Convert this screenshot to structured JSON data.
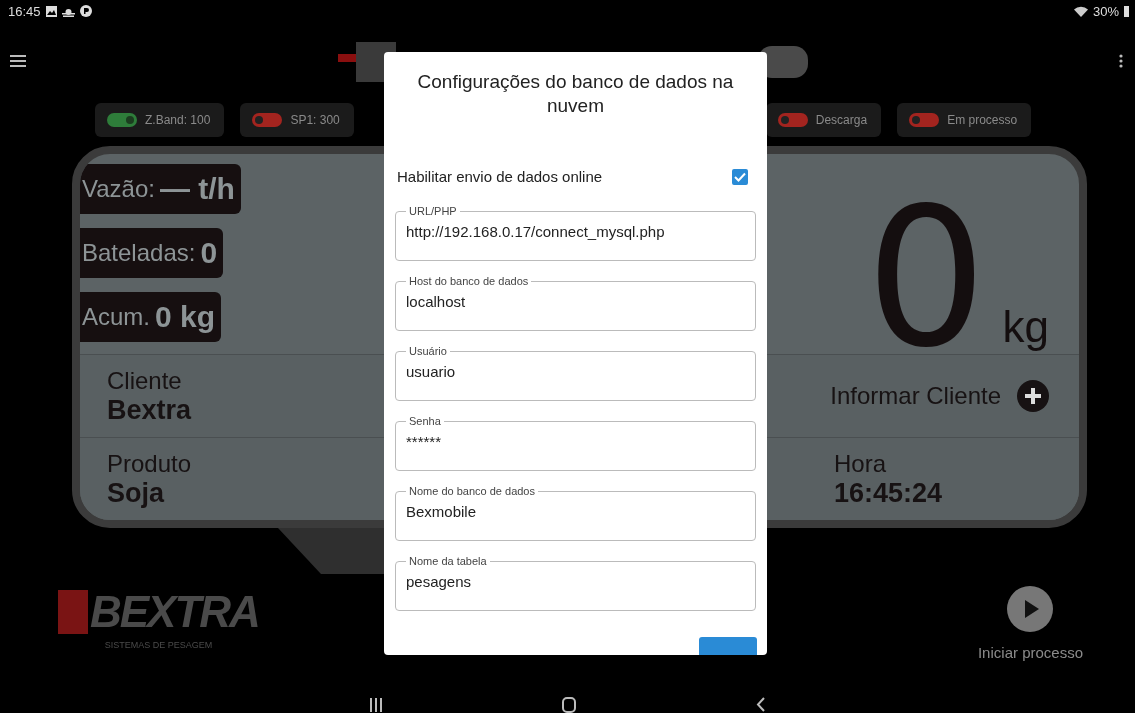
{
  "status_bar": {
    "time": "16:45",
    "battery": "30%"
  },
  "toggles": [
    {
      "label": "Z.Band: 100",
      "on": true
    },
    {
      "label": "SP1: 300",
      "on": false
    },
    {
      "label": "Descarga",
      "on": false
    },
    {
      "label": "Em processo",
      "on": false
    }
  ],
  "stats": [
    {
      "label": "Vazão:",
      "value": "— t/h"
    },
    {
      "label": "Bateladas:",
      "value": "0"
    },
    {
      "label": "Acum.",
      "value": "0 kg"
    }
  ],
  "weight": {
    "value": "0",
    "unit": "kg"
  },
  "info": {
    "client_label": "Cliente",
    "client": "Bextra",
    "client_action": "Informar Cliente",
    "product_label": "Produto",
    "product": "Soja",
    "time_label": "Hora",
    "time": "16:45:24"
  },
  "brand": {
    "name": "BEXTRA",
    "tagline": "SISTEMAS DE PESAGEM"
  },
  "start": {
    "label": "Iniciar processo"
  },
  "dialog": {
    "title": "Configurações do banco de dados na nuvem",
    "option": {
      "label": "Habilitar envio de dados online",
      "checked": true
    },
    "fields": [
      {
        "label": "URL/PHP",
        "value": "http://192.168.0.17/connect_mysql.php"
      },
      {
        "label": "Host do banco de dados",
        "value": "localhost"
      },
      {
        "label": "Usuário",
        "value": "usuario"
      },
      {
        "label": "Senha",
        "value": "******"
      },
      {
        "label": "Nome do banco de dados",
        "value": "Bexmobile"
      },
      {
        "label": "Nome da tabela",
        "value": "pesagens"
      }
    ]
  }
}
